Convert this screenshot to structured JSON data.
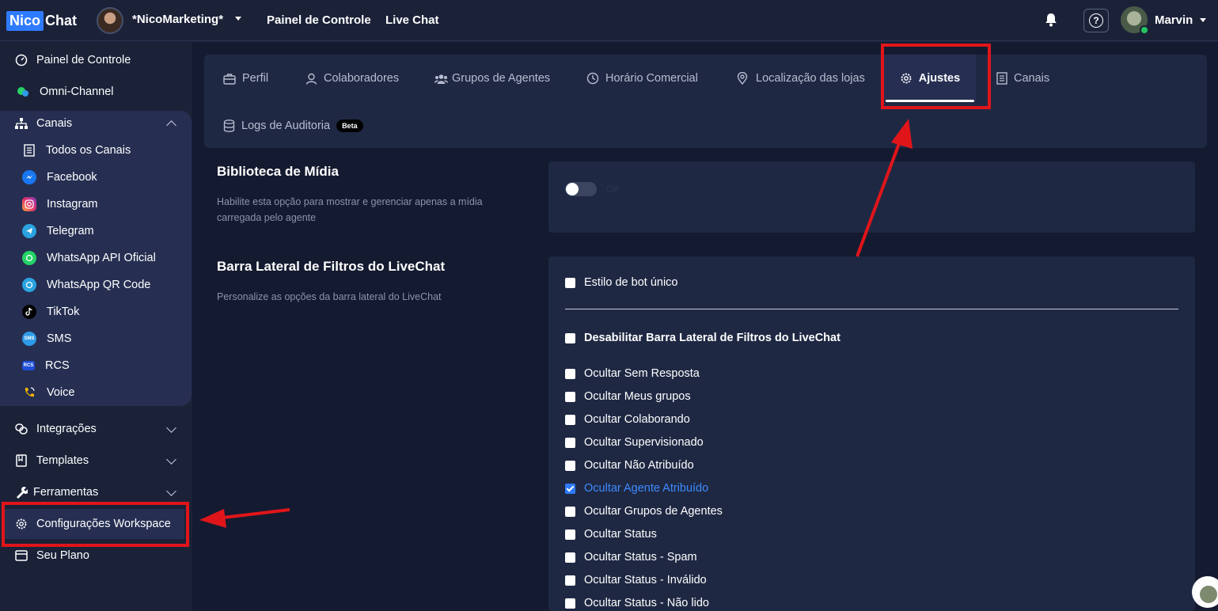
{
  "topbar": {
    "logo_left": "Nico",
    "logo_right": "Chat",
    "workspace": "*NicoMarketing*",
    "nav": [
      "Painel de Controle",
      "Live Chat"
    ],
    "help_glyph": "?",
    "user_name": "Marvin",
    "user_status_color": "#22c55e"
  },
  "sidebar": {
    "painel": "Painel de Controle",
    "omni": "Omni-Channel",
    "canais": "Canais",
    "canais_items": [
      {
        "label": "Todos os Canais",
        "icon": "list-icon"
      },
      {
        "label": "Facebook",
        "icon": "messenger-icon",
        "color": "#1877f2"
      },
      {
        "label": "Instagram",
        "icon": "instagram-icon",
        "color": "#e1306c"
      },
      {
        "label": "Telegram",
        "icon": "telegram-icon",
        "color": "#2aa3df"
      },
      {
        "label": "WhatsApp API Oficial",
        "icon": "whatsapp-icon",
        "color": "#25d366"
      },
      {
        "label": "WhatsApp QR Code",
        "icon": "whatsapp-qr-icon",
        "color": "#2aa3df"
      },
      {
        "label": "TikTok",
        "icon": "tiktok-icon",
        "color": "#000000"
      },
      {
        "label": "SMS",
        "icon": "sms-icon",
        "color": "#2f9be8"
      },
      {
        "label": "RCS",
        "icon": "rcs-icon",
        "color": "#1f4fd6"
      },
      {
        "label": "Voice",
        "icon": "voice-icon",
        "color": "#f5b400"
      }
    ],
    "integracoes": "Integrações",
    "templates": "Templates",
    "ferramentas": "Ferramentas",
    "config": "Configurações Workspace",
    "plano": "Seu Plano"
  },
  "tabs": {
    "perfil": "Perfil",
    "colaboradores": "Colaboradores",
    "grupos": "Grupos de Agentes",
    "horario": "Horário Comercial",
    "localizacao": "Localização das lojas",
    "ajustes": "Ajustes",
    "canais": "Canais",
    "logs": "Logs de Auditoria",
    "beta": "Beta"
  },
  "media": {
    "title": "Biblioteca de Mídia",
    "description": "Habilite esta opção para mostrar e gerenciar apenas a mídia carregada pelo agente",
    "toggle_on": false,
    "toggle_label": "Off"
  },
  "filters": {
    "title": "Barra Lateral de Filtros do LiveChat",
    "description": "Personalize as opções da barra lateral do LiveChat",
    "single_bot": "Estilo de bot único",
    "disable": "Desabilitar Barra Lateral de Filtros do LiveChat",
    "options": [
      {
        "label": "Ocultar Sem Resposta",
        "checked": false
      },
      {
        "label": "Ocultar Meus grupos",
        "checked": false
      },
      {
        "label": "Ocultar Colaborando",
        "checked": false
      },
      {
        "label": "Ocultar Supervisionado",
        "checked": false
      },
      {
        "label": "Ocultar Não Atribuído",
        "checked": false
      },
      {
        "label": "Ocultar Agente Atribuído",
        "checked": true
      },
      {
        "label": "Ocultar Grupos de Agentes",
        "checked": false
      },
      {
        "label": "Ocultar Status",
        "checked": false
      },
      {
        "label": "Ocultar Status - Spam",
        "checked": false
      },
      {
        "label": "Ocultar Status - Inválido",
        "checked": false
      },
      {
        "label": "Ocultar Status - Não lido",
        "checked": false
      }
    ]
  },
  "highlight_color": "#e0151a"
}
